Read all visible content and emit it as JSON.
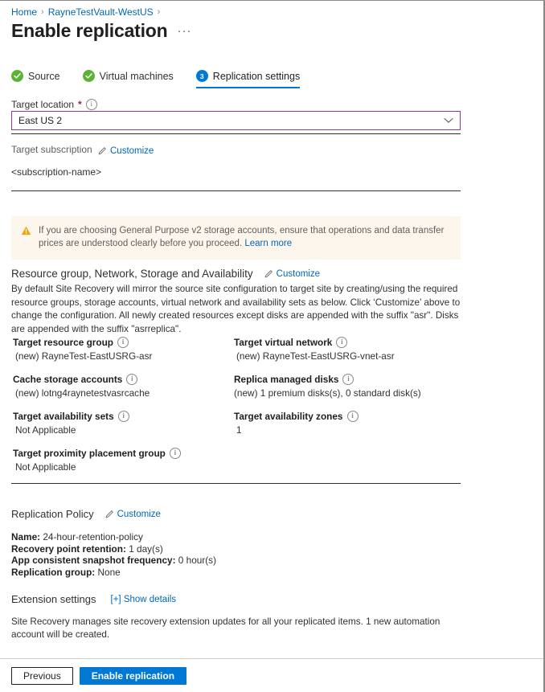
{
  "breadcrumb": {
    "items": [
      {
        "label": "Home"
      },
      {
        "label": "RayneTestVault-WestUS"
      }
    ],
    "separator": "›"
  },
  "header": {
    "title": "Enable replication",
    "ellipsis": "···"
  },
  "steps": [
    {
      "label": "Source",
      "state": "done",
      "badge": "check"
    },
    {
      "label": "Virtual machines",
      "state": "done",
      "badge": "check"
    },
    {
      "label": "Replication settings",
      "state": "active",
      "badge": "3"
    }
  ],
  "target_location": {
    "label": "Target location",
    "required_marker": "*",
    "info": "i",
    "value": "East US 2",
    "chevron": "chevron-down"
  },
  "target_subscription": {
    "label": "Target subscription",
    "customize_label": "Customize",
    "value": "<subscription-name>"
  },
  "warning": {
    "icon": "warning-triangle",
    "text": "If you are choosing General Purpose v2 storage accounts, ensure that operations and data transfer prices are understood clearly before you proceed. ",
    "link_label": "Learn more"
  },
  "resource_group_section": {
    "title": "Resource group, Network, Storage and Availability",
    "customize_label": "Customize",
    "description": "By default Site Recovery will mirror the source site configuration to target site by creating/using the required resource groups, storage accounts, virtual network and availability sets as below. Click ‘Customize’ above to change the configuration. All newly created resources except disks are appended with the suffix \"asr\". Disks are appended with the suffix \"asrreplica\".",
    "left_column": [
      {
        "title": "Target resource group",
        "value": "(new) RayneTest-EastUSRG-asr",
        "info": "i"
      },
      {
        "title": "Cache storage accounts",
        "value": "(new) lotng4raynetestvasrcache",
        "info": "i"
      },
      {
        "title": "Target availability sets",
        "value": "Not Applicable",
        "info": "i"
      },
      {
        "title": "Target proximity placement group",
        "value": "Not Applicable",
        "info": "i"
      }
    ],
    "right_column": [
      {
        "title": "Target virtual network",
        "value": "(new) RayneTest-EastUSRG-vnet-asr",
        "info": "i"
      },
      {
        "title": "Replica managed disks",
        "value": "(new) 1 premium disks(s), 0 standard disk(s)",
        "info": "i"
      },
      {
        "title": "Target availability zones",
        "value": "1",
        "info": "i"
      }
    ]
  },
  "replication_policy": {
    "title": "Replication Policy",
    "customize_label": "Customize",
    "rows": [
      {
        "key": "Name:",
        "value": "24-hour-retention-policy"
      },
      {
        "key": "Recovery point retention:",
        "value": "1 day(s)"
      },
      {
        "key": "App consistent snapshot frequency:",
        "value": "0 hour(s)"
      },
      {
        "key": "Replication group:",
        "value": "None"
      }
    ]
  },
  "extension_settings": {
    "title": "Extension settings",
    "show_details_label": "[+] Show details",
    "description": "Site Recovery manages site recovery extension updates for all your replicated items. 1 new automation account will be created."
  },
  "footer": {
    "previous_label": "Previous",
    "enable_label": "Enable replication"
  },
  "colors": {
    "link": "#0067b8",
    "primary": "#0078d4",
    "success": "#5bb334",
    "warning_bg": "#fdf6ec",
    "warning_icon": "#f0a30a",
    "dropdown_border": "#8c3c8c"
  }
}
